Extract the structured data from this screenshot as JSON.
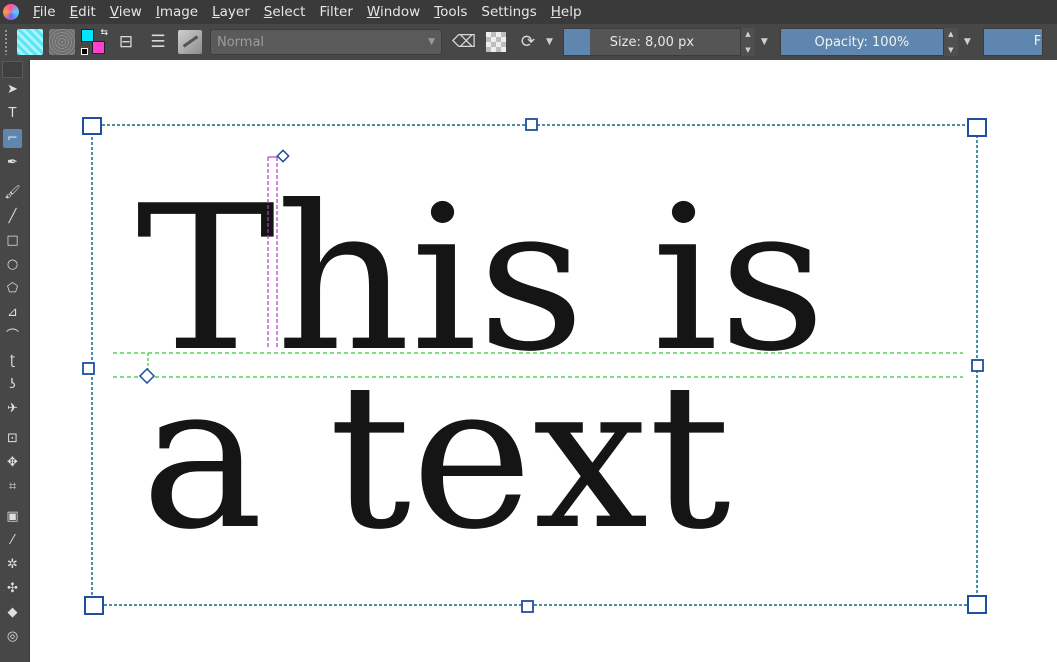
{
  "menu": {
    "items": [
      {
        "label": "File",
        "u": "F",
        "rest": "ile"
      },
      {
        "label": "Edit",
        "u": "E",
        "rest": "dit"
      },
      {
        "label": "View",
        "u": "V",
        "rest": "iew"
      },
      {
        "label": "Image",
        "u": "I",
        "rest": "mage"
      },
      {
        "label": "Layer",
        "u": "L",
        "rest": "ayer"
      },
      {
        "label": "Select",
        "u": "S",
        "rest": "elect"
      },
      {
        "label": "Filter",
        "u": "",
        "rest": "Filter"
      },
      {
        "label": "Window",
        "u": "W",
        "rest": "indow"
      },
      {
        "label": "Tools",
        "u": "T",
        "rest": "ools"
      },
      {
        "label": "Settings",
        "u": "",
        "rest": "Settings"
      },
      {
        "label": "Help",
        "u": "H",
        "rest": "elp"
      }
    ]
  },
  "toolbar": {
    "blend_mode": "Normal",
    "size_label": "Size: 8,00 px",
    "opacity_label": "Opacity: 100%",
    "flow_label": "F",
    "colors": {
      "foreground": "#00e5ff",
      "background": "#ff40d0",
      "accent": "#5f86ae"
    }
  },
  "toolbox": {
    "tools": [
      {
        "name": "select-shapes-tool",
        "glyph": "➤"
      },
      {
        "name": "text-tool",
        "glyph": "T"
      },
      {
        "name": "edit-shapes-tool",
        "glyph": "⌐",
        "active": true
      },
      {
        "name": "calligraphy-tool",
        "glyph": "✒"
      },
      {
        "name": "freehand-brush-tool",
        "glyph": "🖌"
      },
      {
        "name": "line-tool",
        "glyph": "╱"
      },
      {
        "name": "rectangle-tool",
        "glyph": "□"
      },
      {
        "name": "ellipse-tool",
        "glyph": "○"
      },
      {
        "name": "polygon-tool",
        "glyph": "⬠"
      },
      {
        "name": "polyline-tool",
        "glyph": "⊿"
      },
      {
        "name": "bezier-tool",
        "glyph": "⌒"
      },
      {
        "name": "freehand-path-tool",
        "glyph": "ʈ"
      },
      {
        "name": "dynamic-brush-tool",
        "glyph": "ʖ"
      },
      {
        "name": "multibrush-tool",
        "glyph": "✈"
      },
      {
        "name": "transform-tool",
        "glyph": "⊡"
      },
      {
        "name": "move-tool",
        "glyph": "✥"
      },
      {
        "name": "crop-tool",
        "glyph": "⌗"
      },
      {
        "name": "gradient-tool",
        "glyph": "▣"
      },
      {
        "name": "color-picker-tool",
        "glyph": "⁄"
      },
      {
        "name": "smart-patch-tool",
        "glyph": "✲"
      },
      {
        "name": "assistant-tool",
        "glyph": "✣"
      },
      {
        "name": "fill-tool",
        "glyph": "◆"
      },
      {
        "name": "reference-tool",
        "glyph": "◎"
      }
    ]
  },
  "canvas": {
    "text_lines": [
      "This is",
      "a text"
    ],
    "colors": {
      "selection": "#0b6e8a",
      "handle": "#1f4fa0",
      "baseline": "#33cc33",
      "cursor": "#b040c0",
      "text": "#151515"
    }
  }
}
